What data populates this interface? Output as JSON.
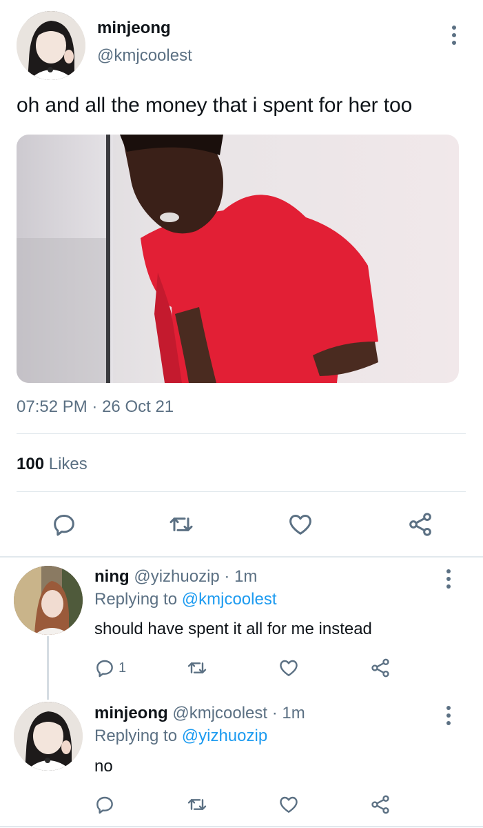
{
  "tweet": {
    "author_name": "minjeong",
    "author_handle": "@kmjcoolest",
    "text": "oh and all the money that i spent for her too",
    "time": "07:52 PM",
    "date": "26 Oct 21",
    "likes_count": "100",
    "likes_label": "Likes",
    "media_description": "man in red shirt gagging"
  },
  "replies": [
    {
      "name": "ning",
      "handle": "@yizhuozip",
      "time": "· 1m",
      "replying_prefix": "Replying to",
      "replying_handle": "@kmjcoolest",
      "text": "should have spent it all for me instead",
      "reply_count": "1"
    },
    {
      "name": "minjeong",
      "handle": "@kmjcoolest",
      "time": "· 1m",
      "replying_prefix": "Replying to",
      "replying_handle": "@yizhuozip",
      "text": "no",
      "reply_count": ""
    }
  ],
  "icons": {
    "reply": "reply-icon",
    "retweet": "retweet-icon",
    "like": "heart-icon",
    "share": "share-icon",
    "more": "more-vertical-icon"
  },
  "colors": {
    "text": "#0f1419",
    "muted": "#5b7083",
    "link": "#1d9bf0",
    "divider": "#e1e8ed"
  }
}
